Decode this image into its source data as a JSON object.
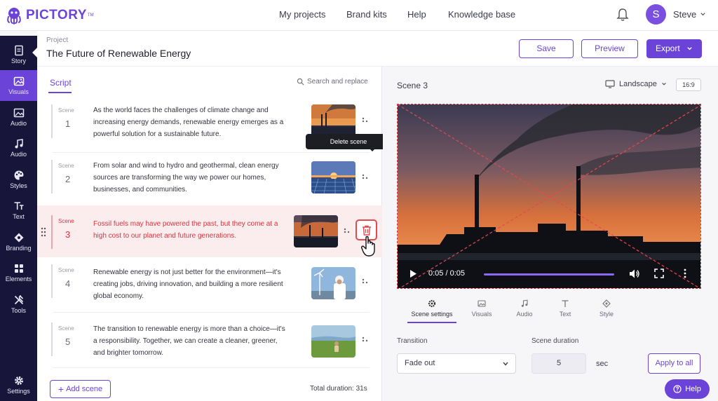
{
  "brand": {
    "name": "PICTORY",
    "tm": "TM"
  },
  "nav": {
    "items": [
      {
        "label": "My projects"
      },
      {
        "label": "Brand kits"
      },
      {
        "label": "Help"
      },
      {
        "label": "Knowledge base"
      }
    ],
    "user": {
      "initial": "S",
      "name": "Steve"
    }
  },
  "sidebar": {
    "items": [
      {
        "label": "Story",
        "icon": "story-icon"
      },
      {
        "label": "Visuals",
        "icon": "visuals-icon",
        "active": true
      },
      {
        "label": "Audio",
        "icon": "image-icon"
      },
      {
        "label": "Audio",
        "icon": "music-icon"
      },
      {
        "label": "Styles",
        "icon": "palette-icon"
      },
      {
        "label": "Text",
        "icon": "text-icon"
      },
      {
        "label": "Branding",
        "icon": "branding-icon"
      },
      {
        "label": "Elements",
        "icon": "elements-icon"
      },
      {
        "label": "Tools",
        "icon": "tools-icon"
      },
      {
        "label": "Settings",
        "icon": "gear-icon"
      }
    ]
  },
  "project": {
    "label": "Project",
    "title": "The Future of Renewable Energy",
    "save_label": "Save",
    "preview_label": "Preview",
    "export_label": "Export"
  },
  "script": {
    "tab_label": "Script",
    "search_label": "Search and replace",
    "scene_word": "Scene",
    "scenes": [
      {
        "number": "1",
        "text": "As the world faces the challenges of climate change and increasing energy demands, renewable energy emerges as a powerful solution for a sustainable future.",
        "thumb": "power-plant-sunset"
      },
      {
        "number": "2",
        "text": "From solar and wind to hydro and geothermal, clean energy sources are transforming the way we power our homes, businesses, and communities.",
        "thumb": "solar-panels-sunset"
      },
      {
        "number": "3",
        "text": "Fossil fuels may have powered the past, but they come at a high cost to our planet and future generations.",
        "thumb": "power-plant-smoke",
        "selected": true
      },
      {
        "number": "4",
        "text": "Renewable energy is not just better for the environment—it's creating jobs, driving innovation, and building a more resilient global economy.",
        "thumb": "wind-turbine-worker"
      },
      {
        "number": "5",
        "text": "The transition to renewable energy is more than a choice—it's a responsibility. Together, we can create a cleaner, greener, and brighter tomorrow.",
        "thumb": "child-in-field"
      }
    ],
    "delete_tooltip": "Delete scene",
    "add_scene_label": "Add scene",
    "total_duration": "Total duration: 31s"
  },
  "preview": {
    "scene_title": "Scene 3",
    "orientation": "Landscape",
    "ratio": "16:9",
    "time": "0:05 / 0:05",
    "progress_fraction": 1.0,
    "tabs": [
      {
        "label": "Scene settings",
        "icon": "scene-settings-icon",
        "active": true
      },
      {
        "label": "Visuals",
        "icon": "image-icon"
      },
      {
        "label": "Audio",
        "icon": "music-icon"
      },
      {
        "label": "Text",
        "icon": "text-icon"
      },
      {
        "label": "Style",
        "icon": "style-icon"
      }
    ],
    "transition_label": "Transition",
    "transition_value": "Fade out",
    "duration_label": "Scene duration",
    "duration_value": "5",
    "duration_unit": "sec",
    "apply_label": "Apply to all"
  },
  "help_label": "Help",
  "colors": {
    "accent": "#6b43d9",
    "danger": "#e5484d",
    "sidebar": "#17153a"
  }
}
